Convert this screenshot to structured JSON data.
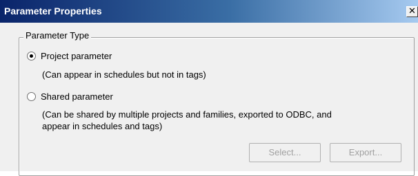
{
  "window": {
    "title": "Parameter Properties",
    "close_glyph": "✕"
  },
  "group": {
    "label": "Parameter Type"
  },
  "options": [
    {
      "label": "Project parameter",
      "selected": true,
      "description": "(Can appear in schedules but not in tags)"
    },
    {
      "label": "Shared parameter",
      "selected": false,
      "description_line1": "(Can be shared by multiple projects and families, exported to ODBC, and",
      "description_line2": "appear in schedules and tags)"
    }
  ],
  "buttons": {
    "select_label": "Select...",
    "export_label": "Export..."
  },
  "colors": {
    "titlebar_start": "#0a246a",
    "titlebar_end": "#a6caf0",
    "disabled_text": "#a0a0a0"
  }
}
